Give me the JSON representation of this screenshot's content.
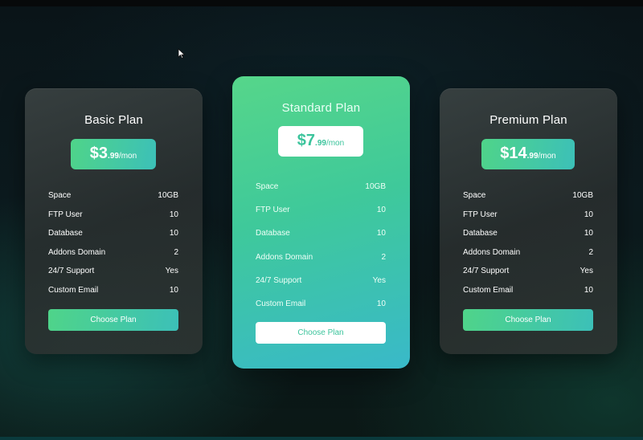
{
  "plans": [
    {
      "name": "Basic Plan",
      "price": {
        "main": "$3",
        "cents": ".99",
        "unit": "/mon"
      },
      "features": [
        {
          "label": "Space",
          "value": "10GB"
        },
        {
          "label": "FTP User",
          "value": "10"
        },
        {
          "label": "Database",
          "value": "10"
        },
        {
          "label": "Addons Domain",
          "value": "2"
        },
        {
          "label": "24/7 Support",
          "value": "Yes"
        },
        {
          "label": "Custom Email",
          "value": "10"
        }
      ],
      "button_label": "Choose Plan"
    },
    {
      "name": "Standard Plan",
      "price": {
        "main": "$7",
        "cents": ".99",
        "unit": "/mon"
      },
      "features": [
        {
          "label": "Space",
          "value": "10GB"
        },
        {
          "label": "FTP User",
          "value": "10"
        },
        {
          "label": "Database",
          "value": "10"
        },
        {
          "label": "Addons Domain",
          "value": "2"
        },
        {
          "label": "24/7 Support",
          "value": "Yes"
        },
        {
          "label": "Custom Email",
          "value": "10"
        }
      ],
      "button_label": "Choose Plan"
    },
    {
      "name": "Premium Plan",
      "price": {
        "main": "$14",
        "cents": ".99",
        "unit": "/mon"
      },
      "features": [
        {
          "label": "Space",
          "value": "10GB"
        },
        {
          "label": "FTP User",
          "value": "10"
        },
        {
          "label": "Database",
          "value": "10"
        },
        {
          "label": "Addons Domain",
          "value": "2"
        },
        {
          "label": "24/7 Support",
          "value": "Yes"
        },
        {
          "label": "Custom Email",
          "value": "10"
        }
      ],
      "button_label": "Choose Plan"
    }
  ],
  "colors": {
    "accent_start": "#56d68a",
    "accent_end": "#39b9c9",
    "card_dark": "#353c3c",
    "background": "#0b1618"
  },
  "icons": {
    "cursor": "mouse-pointer-icon"
  }
}
